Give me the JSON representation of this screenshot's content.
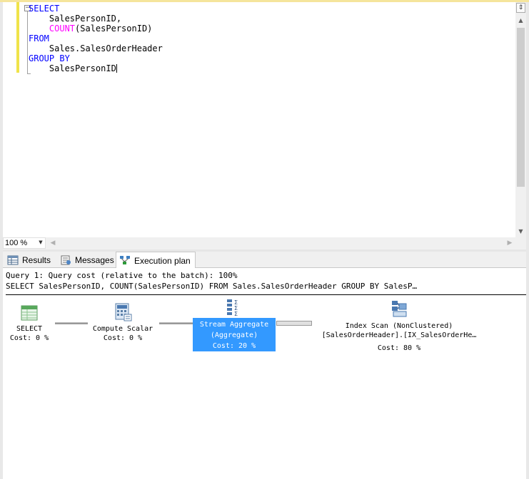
{
  "editor": {
    "lines": [
      {
        "parts": [
          {
            "t": "SELECT",
            "c": "kw"
          }
        ]
      },
      {
        "parts": [
          {
            "t": "    SalesPersonID,",
            "c": ""
          }
        ]
      },
      {
        "parts": [
          {
            "t": "    ",
            "c": ""
          },
          {
            "t": "COUNT",
            "c": "fn"
          },
          {
            "t": "(SalesPersonID)",
            "c": ""
          }
        ]
      },
      {
        "parts": [
          {
            "t": "FROM",
            "c": "kw"
          }
        ]
      },
      {
        "parts": [
          {
            "t": "    Sales.SalesOrderHeader",
            "c": ""
          }
        ]
      },
      {
        "parts": [
          {
            "t": "GROUP BY",
            "c": "kw"
          }
        ]
      },
      {
        "parts": [
          {
            "t": "    SalesPersonID",
            "c": ""
          }
        ]
      }
    ],
    "collapse_symbol": "−"
  },
  "zoom": {
    "value": "100 %"
  },
  "tabs": {
    "results": "Results",
    "messages": "Messages",
    "plan": "Execution plan"
  },
  "plan": {
    "header_line1": "Query 1: Query cost (relative to the batch): 100%",
    "header_line2": "SELECT SalesPersonID, COUNT(SalesPersonID) FROM Sales.SalesOrderHeader GROUP BY SalesP…",
    "nodes": {
      "select": {
        "name": "SELECT",
        "cost": "Cost: 0 %"
      },
      "compute": {
        "name": "Compute Scalar",
        "cost": "Cost: 0 %"
      },
      "aggregate": {
        "name": "Stream Aggregate",
        "sub": "(Aggregate)",
        "cost": "Cost: 20 %"
      },
      "scan": {
        "name": "Index Scan (NonClustered)",
        "sub": "[SalesOrderHeader].[IX_SalesOrderHe…",
        "cost": "Cost: 80 %"
      }
    }
  },
  "colors": {
    "keyword": "#0000ff",
    "function": "#ff00ff",
    "selection": "#3399ff",
    "change_bar": "#f0e34a"
  },
  "icons": [
    "table-select-icon",
    "compute-scalar-icon",
    "stream-aggregate-icon",
    "index-scan-icon",
    "results-grid-icon",
    "messages-icon",
    "execution-plan-icon"
  ]
}
